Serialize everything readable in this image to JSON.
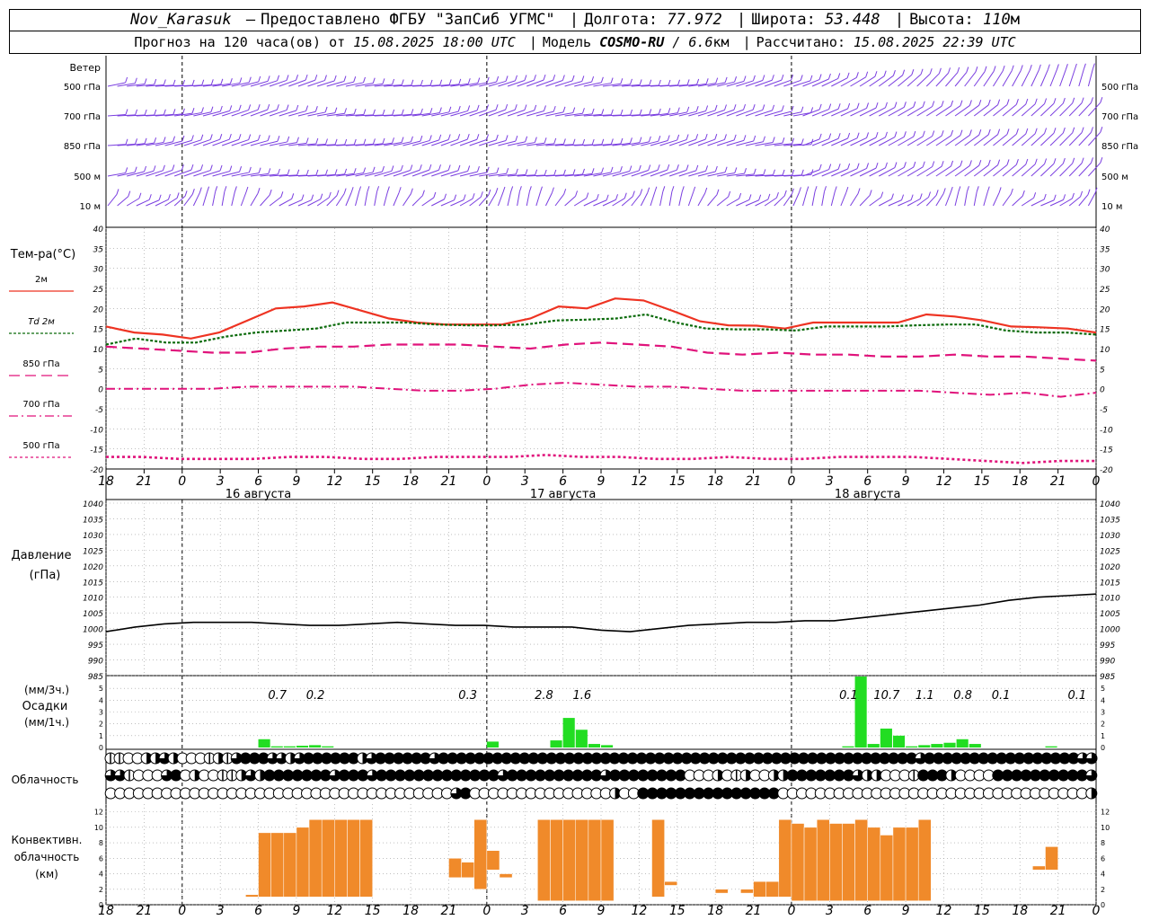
{
  "header": {
    "station": "Nov_Karasuk",
    "provider": "Предоставлено ФГБУ \"ЗапСиб УГМС\"",
    "lon_label": "Долгота:",
    "lon_value": "77.972",
    "lat_label": "Широта:",
    "lat_value": "53.448",
    "alt_label": "Высота:",
    "alt_value": "110",
    "alt_unit": "м",
    "forecast_label": "Прогноз на 120 часа(ов) от",
    "forecast_start": "15.08.2025 18:00 UTC",
    "model_label": "Модель",
    "model_name": "COSMO-RU",
    "model_res": "/ 6.6",
    "model_res_unit": "км",
    "computed_label": "Рассчитано:",
    "computed_time": "15.08.2025 22:39 UTC"
  },
  "wind_panel": {
    "title": "Ветер",
    "levels": [
      "500 гПа",
      "700 гПа",
      "850 гПа",
      "500 м",
      "10 м"
    ]
  },
  "time_axis": {
    "ticks": [
      "18",
      "21",
      "0",
      "3",
      "6",
      "9",
      "12",
      "15",
      "18",
      "21",
      "0",
      "3",
      "6",
      "9",
      "12",
      "15",
      "18",
      "21",
      "0",
      "3",
      "6",
      "9",
      "12",
      "15",
      "18",
      "21",
      "0"
    ],
    "dates": [
      "16 августа",
      "17 августа",
      "18 августа"
    ]
  },
  "colors": {
    "t2m": "#ee3322",
    "td2m": "#0a6a0a",
    "t850": "#e0137b",
    "t700": "#e0137b",
    "t500": "#e0137b",
    "wind": "#7a3ee0",
    "precip": "#22dd22",
    "convective": "#f08a2a",
    "pressure": "#000000"
  },
  "chart_data": [
    {
      "type": "line",
      "name": "temperature",
      "ylabel": "Тем-ра(°C)",
      "ylim": [
        -20,
        40
      ],
      "y_ticks": [
        "40",
        "35",
        "30",
        "25",
        "20",
        "15",
        "10",
        "5",
        "0",
        "-5",
        "-10",
        "-15",
        "-20"
      ],
      "x_hours": [
        0,
        3,
        6,
        9,
        12,
        15,
        18,
        21,
        24,
        27,
        30,
        33,
        36,
        39,
        42,
        45,
        48,
        51,
        54,
        57,
        60,
        63,
        66,
        69,
        72,
        75,
        78,
        81
      ],
      "series": [
        {
          "name": "2м",
          "legend_prefix": "",
          "values": [
            15.5,
            14,
            13.5,
            12.5,
            14,
            17,
            20,
            20.5,
            21.5,
            19.5,
            17.5,
            16.5,
            16,
            16,
            16,
            17.5,
            20.5,
            20,
            22.5,
            22,
            19.5,
            16.8,
            15.8,
            15.7,
            15,
            16.5,
            16.5,
            16.5,
            16.5,
            18.5,
            18,
            17,
            15.5,
            15.3,
            15,
            14
          ]
        },
        {
          "name": "2м",
          "legend_prefix": "Td",
          "values": [
            11,
            12.5,
            11.5,
            11.5,
            13,
            14,
            14.5,
            15,
            16.5,
            16.5,
            16.5,
            16,
            15.8,
            15.8,
            16,
            17,
            17.2,
            17.5,
            18.5,
            16.5,
            15,
            14.8,
            14.8,
            14.5,
            15.5,
            15.5,
            15.5,
            15.8,
            16,
            16,
            14.5,
            14,
            14,
            13.5
          ]
        },
        {
          "name": "850 гПа",
          "values": [
            10.5,
            10,
            9.5,
            9,
            9,
            10,
            10.5,
            10.5,
            11,
            11,
            11,
            10.5,
            10,
            11,
            11.5,
            11,
            10.5,
            9,
            8.5,
            9,
            8.5,
            8.5,
            8,
            8,
            8.5,
            8,
            8,
            7.5,
            7
          ]
        },
        {
          "name": "700 гПа",
          "values": [
            0,
            0,
            0,
            0,
            0.5,
            0.5,
            0.5,
            0.5,
            0,
            -0.5,
            -0.5,
            0,
            1,
            1.5,
            1,
            0.5,
            0.5,
            0,
            -0.5,
            -0.5,
            -0.5,
            -0.5,
            -0.5,
            -0.5,
            -1,
            -1.5,
            -1,
            -2,
            -1
          ]
        },
        {
          "name": "500 гПа",
          "values": [
            -17,
            -17,
            -17.5,
            -17.5,
            -17.5,
            -17,
            -17,
            -17.5,
            -17.5,
            -17,
            -17,
            -17,
            -16.5,
            -17,
            -17,
            -17.5,
            -17.5,
            -17,
            -17.5,
            -17.5,
            -17,
            -17,
            -17,
            -17.5,
            -18,
            -18.5,
            -18,
            -18
          ]
        }
      ]
    },
    {
      "type": "line",
      "name": "pressure",
      "ylabel": "Давление",
      "yunit": "(гПа)",
      "ylim": [
        985,
        1040
      ],
      "y_ticks": [
        "1040",
        "1035",
        "1030",
        "1025",
        "1020",
        "1015",
        "1010",
        "1005",
        "1000",
        "995",
        "990",
        "985"
      ],
      "series": [
        {
          "name": "",
          "values": [
            999,
            1000.5,
            1001.5,
            1002,
            1002,
            1002,
            1001.5,
            1001,
            1001,
            1001.5,
            1002,
            1001.5,
            1001,
            1001,
            1000.5,
            1000.5,
            1000.5,
            999.5,
            999,
            1000,
            1001,
            1001.5,
            1002,
            1002,
            1002.5,
            1002.5,
            1003.5,
            1004.5,
            1005.5,
            1006.5,
            1007.5,
            1009,
            1010,
            1010.5,
            1011
          ]
        }
      ]
    },
    {
      "type": "bar",
      "name": "precipitation",
      "ylabel": "Осадки",
      "yunit_top": "(мм/3ч.)",
      "yunit_bottom": "(мм/1ч.)",
      "ylim": [
        0,
        6
      ],
      "y_ticks": [
        "5",
        "4",
        "3",
        "2",
        "1",
        "0"
      ],
      "hourly_bars": [
        {
          "h": 12,
          "v": 0.7
        },
        {
          "h": 13,
          "v": 0.1
        },
        {
          "h": 14,
          "v": 0.1
        },
        {
          "h": 15,
          "v": 0.15
        },
        {
          "h": 16,
          "v": 0.2
        },
        {
          "h": 17,
          "v": 0.1
        },
        {
          "h": 30,
          "v": 0.5
        },
        {
          "h": 35,
          "v": 0.6
        },
        {
          "h": 36,
          "v": 2.5
        },
        {
          "h": 37,
          "v": 1.5
        },
        {
          "h": 38,
          "v": 0.3
        },
        {
          "h": 39,
          "v": 0.2
        },
        {
          "h": 58,
          "v": 0.1
        },
        {
          "h": 59,
          "v": 6
        },
        {
          "h": 60,
          "v": 0.3
        },
        {
          "h": 61,
          "v": 1.6
        },
        {
          "h": 62,
          "v": 1.0
        },
        {
          "h": 63,
          "v": 0.1
        },
        {
          "h": 64,
          "v": 0.2
        },
        {
          "h": 65,
          "v": 0.3
        },
        {
          "h": 66,
          "v": 0.4
        },
        {
          "h": 67,
          "v": 0.7
        },
        {
          "h": 68,
          "v": 0.3
        },
        {
          "h": 74,
          "v": 0.1
        }
      ],
      "totals_3h": [
        {
          "h": 13.5,
          "label": "0.7"
        },
        {
          "h": 16.5,
          "label": "0.2"
        },
        {
          "h": 28.5,
          "label": "0.3"
        },
        {
          "h": 34.5,
          "label": "2.8"
        },
        {
          "h": 37.5,
          "label": "1.6"
        },
        {
          "h": 58.5,
          "label": "0.1"
        },
        {
          "h": 61.5,
          "label": "10.7"
        },
        {
          "h": 64.5,
          "label": "1.1"
        },
        {
          "h": 67.5,
          "label": "0.8"
        },
        {
          "h": 70.5,
          "label": "0.1"
        },
        {
          "h": 76.5,
          "label": "0.1"
        }
      ]
    },
    {
      "type": "table",
      "name": "cloudiness",
      "ylabel": "Облачность",
      "rows": [
        [
          1,
          1,
          0,
          0,
          2,
          2,
          3,
          2,
          0,
          0,
          0,
          1,
          2,
          1,
          3,
          4,
          4,
          4,
          3,
          3,
          2,
          3,
          4,
          4,
          4,
          4,
          4,
          4,
          2,
          3,
          4,
          4,
          4,
          4,
          4,
          4,
          3,
          4,
          4,
          4,
          4,
          4,
          4,
          4,
          4,
          4,
          4,
          4,
          4,
          4,
          4,
          4,
          4,
          4,
          4,
          4,
          4,
          4,
          4,
          4,
          4,
          4,
          4,
          4,
          4,
          4,
          4,
          4,
          4,
          4,
          4,
          4,
          4,
          4,
          4,
          4,
          4,
          4,
          4,
          4,
          4,
          4,
          4,
          4,
          4,
          4,
          4,
          4,
          4,
          4,
          3,
          4,
          4,
          4,
          4,
          4,
          4,
          4,
          4,
          4,
          4,
          4,
          4,
          4,
          4,
          4,
          4,
          4,
          3,
          3
        ],
        [
          3,
          3,
          1,
          0,
          0,
          0,
          3,
          4,
          0,
          2,
          0,
          0,
          1,
          1,
          2,
          3,
          2,
          4,
          4,
          4,
          4,
          4,
          4,
          4,
          3,
          4,
          4,
          4,
          3,
          4,
          4,
          4,
          4,
          4,
          4,
          4,
          4,
          4,
          4,
          4,
          4,
          4,
          3,
          4,
          4,
          4,
          4,
          4,
          4,
          4,
          4,
          4,
          4,
          3,
          4,
          4,
          4,
          4,
          4,
          4,
          4,
          4,
          0,
          0,
          0,
          2,
          0,
          1,
          2,
          0,
          0,
          2,
          2,
          4,
          4,
          4,
          4,
          4,
          4,
          4,
          3,
          2,
          2,
          0,
          0,
          0,
          1,
          4,
          4,
          4,
          2,
          0,
          0,
          0,
          0,
          4,
          4,
          4,
          4,
          4,
          4,
          4,
          4,
          4,
          4,
          3
        ],
        [
          0,
          0,
          0,
          0,
          0,
          0,
          0,
          0,
          0,
          0,
          0,
          0,
          0,
          0,
          0,
          0,
          0,
          0,
          0,
          0,
          0,
          0,
          0,
          0,
          0,
          0,
          0,
          0,
          0,
          0,
          0,
          0,
          0,
          0,
          0,
          0,
          0,
          3,
          4,
          0,
          0,
          0,
          0,
          0,
          0,
          0,
          0,
          0,
          0,
          0,
          0,
          0,
          0,
          0,
          2,
          0,
          0,
          4,
          4,
          4,
          4,
          4,
          4,
          4,
          4,
          4,
          4,
          4,
          4,
          4,
          4,
          4,
          0,
          0,
          0,
          0,
          0,
          0,
          0,
          0,
          0,
          0,
          0,
          0,
          0,
          0,
          0,
          0,
          0,
          0,
          0,
          0,
          0,
          0,
          0,
          0,
          0,
          0,
          0,
          0,
          0,
          0,
          0,
          0,
          0,
          2
        ]
      ]
    },
    {
      "type": "bar",
      "name": "convective_cloud",
      "ylabel": "Конвективн.",
      "ylabel2": "облачность",
      "yunit": "(км)",
      "ylim": [
        0,
        13
      ],
      "y_ticks": [
        "12",
        "10",
        "8",
        "6",
        "4",
        "2",
        "0"
      ],
      "bars": [
        {
          "h": 11.5,
          "lo": 1,
          "hi": 1.3
        },
        {
          "h": 12.5,
          "lo": 1,
          "hi": 9.3
        },
        {
          "h": 13.5,
          "lo": 1,
          "hi": 9.3
        },
        {
          "h": 14.5,
          "lo": 1,
          "hi": 9.3
        },
        {
          "h": 15.5,
          "lo": 1,
          "hi": 10
        },
        {
          "h": 16.5,
          "lo": 1,
          "hi": 11
        },
        {
          "h": 17.5,
          "lo": 1,
          "hi": 11
        },
        {
          "h": 18.5,
          "lo": 1,
          "hi": 11
        },
        {
          "h": 19.5,
          "lo": 1,
          "hi": 11
        },
        {
          "h": 20.5,
          "lo": 1,
          "hi": 11
        },
        {
          "h": 27.5,
          "lo": 3.5,
          "hi": 6
        },
        {
          "h": 28.5,
          "lo": 3.5,
          "hi": 5.5
        },
        {
          "h": 29.5,
          "lo": 2,
          "hi": 11
        },
        {
          "h": 30.5,
          "lo": 4.5,
          "hi": 7
        },
        {
          "h": 31.5,
          "lo": 3.5,
          "hi": 4
        },
        {
          "h": 34.5,
          "lo": 0.5,
          "hi": 11
        },
        {
          "h": 35.5,
          "lo": 0.5,
          "hi": 11
        },
        {
          "h": 36.5,
          "lo": 0.5,
          "hi": 11
        },
        {
          "h": 37.5,
          "lo": 0.5,
          "hi": 11
        },
        {
          "h": 38.5,
          "lo": 0.5,
          "hi": 11
        },
        {
          "h": 39.5,
          "lo": 0.5,
          "hi": 11
        },
        {
          "h": 43.5,
          "lo": 1,
          "hi": 11
        },
        {
          "h": 44.5,
          "lo": 2.5,
          "hi": 3
        },
        {
          "h": 48.5,
          "lo": 1.5,
          "hi": 2
        },
        {
          "h": 50.5,
          "lo": 1.5,
          "hi": 2
        },
        {
          "h": 51.5,
          "lo": 1,
          "hi": 3
        },
        {
          "h": 52.5,
          "lo": 1,
          "hi": 3
        },
        {
          "h": 53.5,
          "lo": 1,
          "hi": 11
        },
        {
          "h": 54.5,
          "lo": 0.5,
          "hi": 10.5
        },
        {
          "h": 55.5,
          "lo": 0.5,
          "hi": 10
        },
        {
          "h": 56.5,
          "lo": 0.5,
          "hi": 11
        },
        {
          "h": 57.5,
          "lo": 0.5,
          "hi": 10.5
        },
        {
          "h": 58.5,
          "lo": 0.5,
          "hi": 10.5
        },
        {
          "h": 59.5,
          "lo": 0.5,
          "hi": 11
        },
        {
          "h": 60.5,
          "lo": 0.5,
          "hi": 10
        },
        {
          "h": 61.5,
          "lo": 0.5,
          "hi": 9
        },
        {
          "h": 62.5,
          "lo": 0.5,
          "hi": 10
        },
        {
          "h": 63.5,
          "lo": 0.5,
          "hi": 10
        },
        {
          "h": 64.5,
          "lo": 0.5,
          "hi": 11
        },
        {
          "h": 73.5,
          "lo": 4.5,
          "hi": 5
        },
        {
          "h": 74.5,
          "lo": 4.5,
          "hi": 7.5
        }
      ]
    }
  ]
}
